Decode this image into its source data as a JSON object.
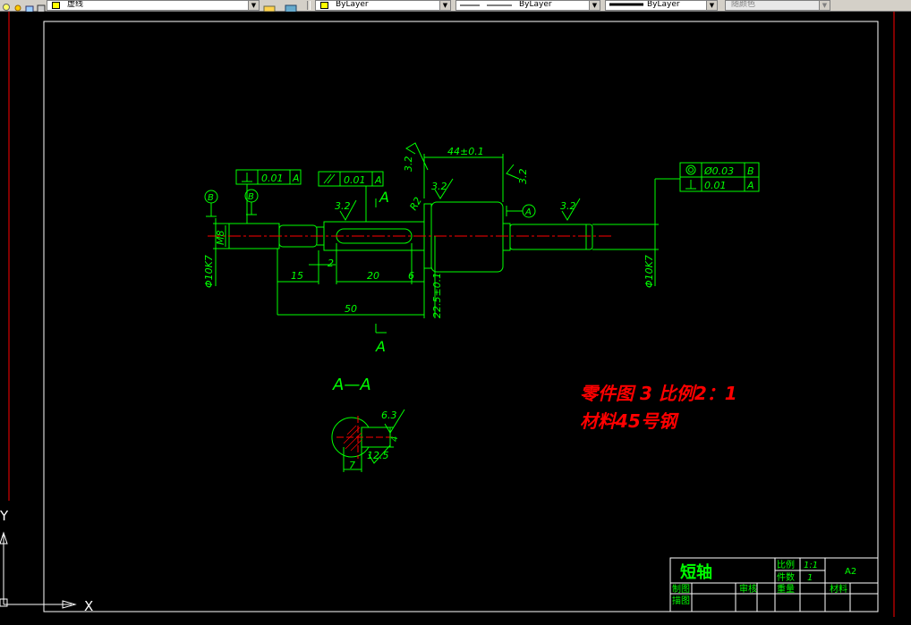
{
  "toolbar": {
    "layer_name": "虚线",
    "color_value": "ByLayer",
    "linetype_value": "ByLayer",
    "lineweight_value": "ByLayer",
    "plotstyle_value": "随颜色",
    "colors": {
      "layer_swatch": "#ffff00",
      "color_swatch": "#ffff00"
    }
  },
  "drawing": {
    "colors": {
      "background": "#000000",
      "geometry": "#00ff00",
      "centerline": "#ff0000",
      "note": "#ff0000",
      "frame": "#ffffff",
      "text": "#00ff00"
    },
    "tolerances": {
      "runout_left": "0.01",
      "datum_left": "A",
      "parallel": "0.01",
      "datum_parallel": "A",
      "concentric": "Ø0.03",
      "datum_concentric": "B",
      "perpendicular": "0.01",
      "datum_perp": "A"
    },
    "datums": {
      "b1": "B",
      "b2": "B",
      "a": "A"
    },
    "roughness": {
      "r1": "3.2",
      "r2": "3.2",
      "r3": "3.2",
      "r4": "3.2",
      "r5": "3.2",
      "r6": "6.3",
      "r7": "12.5"
    },
    "dimensions": {
      "d_44": "44±0.1",
      "d_m8": "M8",
      "d_phi_left": "Φ10K7",
      "d_phi_right": "Φ10K7",
      "d_15": "15",
      "d_2": "2",
      "d_20": "20",
      "d_6": "6",
      "d_50": "50",
      "d_22": "22.5±0.1",
      "d_r2": "R2",
      "d_7": "7",
      "d_4": "4"
    },
    "section": {
      "mark_top": "A",
      "mark_bottom": "A",
      "label": "A—A"
    },
    "note_line1": "零件图  3  比例2：1",
    "note_line2": "材料45号钢",
    "title_block": {
      "part_name": "短轴",
      "scale_label": "比例",
      "scale_value": "1:1",
      "qty_label": "件数",
      "qty_value": "1",
      "sheet_size": "A2",
      "drawn_label": "制图",
      "checked_label": "审核",
      "weight_label": "重量",
      "material_label": "材料",
      "drafter_label": "描图"
    },
    "ucs": {
      "x_label": "X",
      "y_label": "Y"
    }
  }
}
